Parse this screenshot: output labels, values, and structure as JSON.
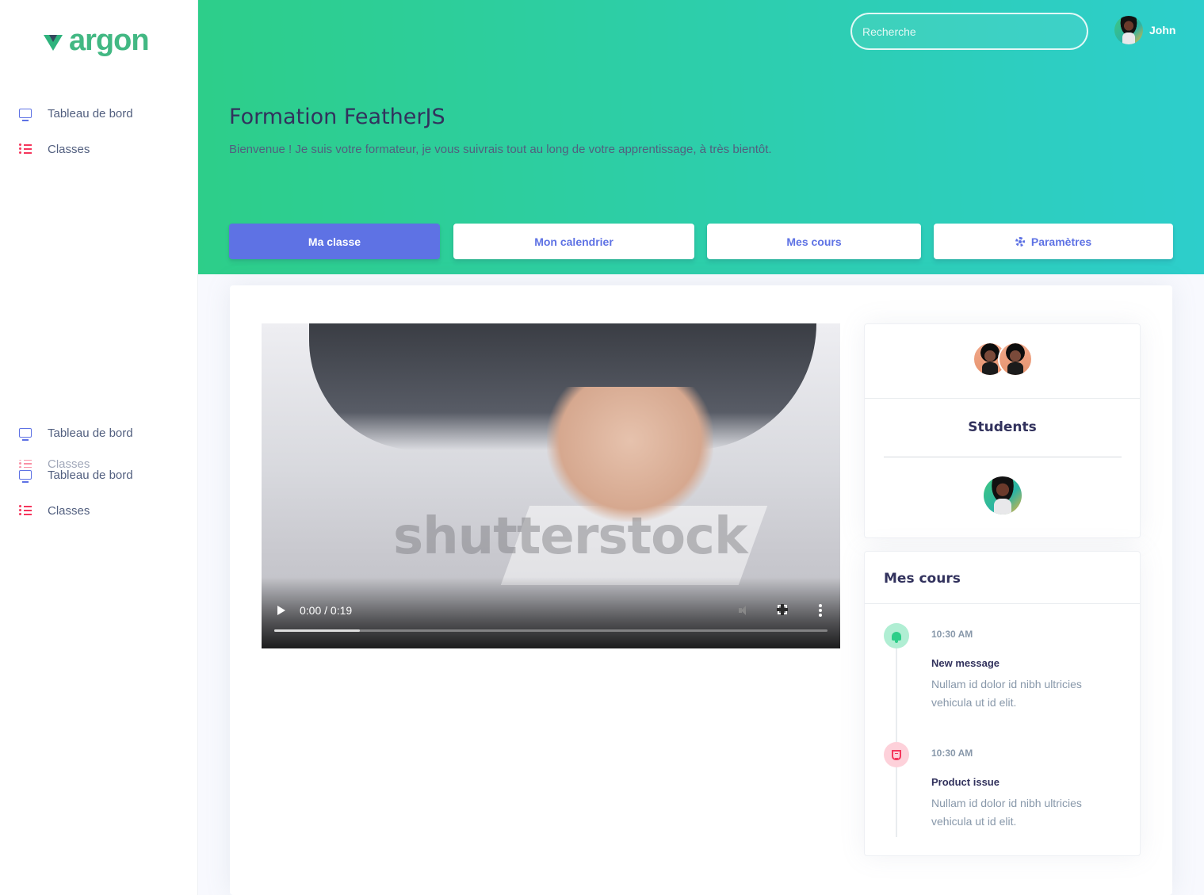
{
  "brand": {
    "name": "argon"
  },
  "sidebar": {
    "items": [
      {
        "label": "Tableau de bord",
        "icon": "tv-icon"
      },
      {
        "label": "Classes",
        "icon": "list-icon"
      },
      {
        "label": "Tableau de bord",
        "icon": "tv-icon"
      },
      {
        "label": "Classes",
        "icon": "list-icon"
      },
      {
        "label": "Tableau de bord",
        "icon": "tv-icon"
      },
      {
        "label": "Classes",
        "icon": "list-icon"
      }
    ]
  },
  "header": {
    "search_placeholder": "Recherche",
    "user_name": "John",
    "title": "Formation FeatherJS",
    "subtitle": "Bienvenue ! Je suis votre formateur, je vous suivrais tout au long de votre apprentissage, à très bientôt.",
    "tabs": [
      {
        "label": "Ma classe",
        "active": true
      },
      {
        "label": "Mon calendrier",
        "active": false
      },
      {
        "label": "Mes cours",
        "active": false
      },
      {
        "label": "Paramètres",
        "active": false,
        "icon": "gear-icon"
      }
    ]
  },
  "video": {
    "watermark": "shutterstock",
    "time": "0:00 / 0:19",
    "buffered_fraction": 0.155
  },
  "students_card": {
    "heading": "Students"
  },
  "courses_card": {
    "heading": "Mes cours",
    "items": [
      {
        "time": "10:30 AM",
        "title": "New message",
        "text": "Nullam id dolor id nibh ultricies vehicula ut id elit.",
        "icon": "bell-icon",
        "color": "#2dce89"
      },
      {
        "time": "10:30 AM",
        "title": "Product issue",
        "text": "Nullam id dolor id nibh ultricies vehicula ut id elit.",
        "icon": "html5-icon",
        "color": "#f5365c"
      }
    ]
  },
  "colors": {
    "primary": "#5e72e4",
    "success": "#2dce89",
    "info_gradient_end": "#2dcecc",
    "danger": "#f5365c",
    "heading": "#32325d"
  }
}
